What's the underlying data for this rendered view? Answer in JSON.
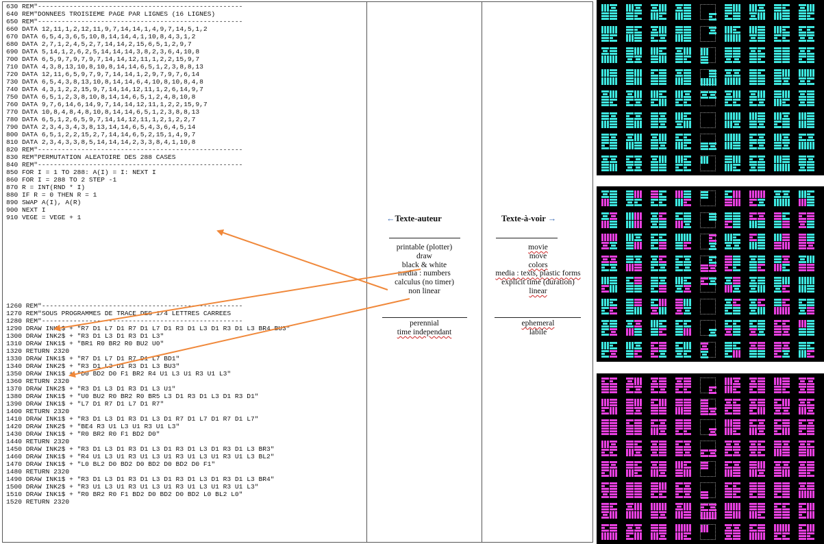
{
  "code_top": [
    "630 REM\"----------------------------------------------------",
    "640 REM\"DONNEES TROISIEME PAGE PAR LIGNES (16 LIGNES)",
    "650 REM\"----------------------------------------------------",
    "660 DATA 12,11,1,2,12,11,9,7,14,14,1,4,9,7,14,5,1,2",
    "670 DATA 6,5,4,3,6,5,10,8,14,14,4,1,10,8,4,3,1,2",
    "680 DATA 2,7,1,2,4,5,2,7,14,14,2,15,6,5,1,2,9,7",
    "690 DATA 5,14,1,2,6,2,5,14,14,14,3,8,2,3,6,4,10,8",
    "700 DATA 6,5,9,7,9,7,9,7,14,14,12,11,1,2,2,15,9,7",
    "710 DATA 4,3,8,13,10,8,10,8,14,14,6,5,1,2,3,8,8,13",
    "720 DATA 12,11,6,5,9,7,9,7,14,14,1,2,9,7,9,7,6,14",
    "730 DATA 6,5,4,3,8,13,10,8,14,14,6,4,10,8,10,8,4,8",
    "740 DATA 4,3,1,2,2,15,9,7,14,14,12,11,1,2,6,14,9,7",
    "750 DATA 6,5,1,2,3,8,10,8,14,14,6,5,1,2,4,8,10,8",
    "760 DATA 9,7,6,14,6,14,9,7,14,14,12,11,1,2,2,15,9,7",
    "770 DATA 10,8,4,8,4,8,10,8,14,14,6,5,1,2,3,8,8,13",
    "780 DATA 6,5,1,2,6,5,9,7,14,14,12,11,1,2,1,2,2,7",
    "790 DATA 2,3,4,3,4,3,8,13,14,14,6,5,4,3,6,4,5,14",
    "800 DATA 6,5,1,2,2,15,2,7,14,14,6,5,2,15,1,4,9,7",
    "810 DATA 2,3,4,3,3,8,5,14,14,14,2,3,3,8,4,1,10,8",
    "820 REM\"----------------------------------------------------",
    "830 REM\"PERMUTATION ALEATOIRE DES 288 CASES",
    "840 REM\"----------------------------------------------------",
    "850 FOR I = 1 TO 288: A(I) = I: NEXT I",
    "860 FOR I = 288 TO 2 STEP -1",
    "870 R = INT(RND * I)",
    "880 IF R = 0 THEN R = 1",
    "890 SWAP A(I), A(R)",
    "900 NEXT I",
    "910 VEGE = VEGE + 1"
  ],
  "code_bottom": [
    "1260 REM\"---------------------------------------------------",
    "1270 REM\"SOUS PROGRAMMES DE TRACE DES 1/4 LETTRES CARREES",
    "1280 REM\"---------------------------------------------------",
    "1290 DRAW INK1$ + \"R7 D1 L7 D1 R7 D1 L7 D1 R3 D1 L3 D1 R3 D1 L3 BR4 BU3\"",
    "1300 DRAW INK2$ + \"R3 D1 L3 D1 R3 D1 L3\"",
    "1310 DRAW INK1$ + \"BR1 R0 BR2 R0 BU2 U0\"",
    "1320 RETURN 2320",
    "1330 DRAW INK1$ + \"R7 D1 L7 D1 R7 D1 L7 BD1\"",
    "1340 DRAW INK2$ + \"R3 D1 L3 D1 R3 D1 L3 BU3\"",
    "1350 DRAW INK1$ + \"D0 BD2 D0 F1 BR2 R4 U1 L3 U1 R3 U1 L3\"",
    "1360 RETURN 2320",
    "1370 DRAW INK2$ + \"R3 D1 L3 D1 R3 D1 L3 U1\"",
    "1380 DRAW INK1$ + \"U0 BU2 R0 BR2 R0 BR5 L3 D1 R3 D1 L3 D1 R3 D1\"",
    "1390 DRAW INK1$ + \"L7 D1 R7 D1 L7 D1 R7\"",
    "1400 RETURN 2320",
    "1410 DRAW INK1$ + \"R3 D1 L3 D1 R3 D1 L3 D1 R7 D1 L7 D1 R7 D1 L7\"",
    "1420 DRAW INK2$ + \"BE4 R3 U1 L3 U1 R3 U1 L3\"",
    "1430 DRAW INK1$ + \"R0 BR2 R0 F1 BD2 D0\"",
    "1440 RETURN 2320",
    "1450 DRAW INK2$ + \"R3 D1 L3 D1 R3 D1 L3 D1 R3 D1 L3 D1 R3 D1 L3 BR3\"",
    "1460 DRAW INK1$ + \"R4 U1 L3 U1 R3 U1 L3 U1 R3 U1 L3 U1 R3 U1 L3 BL2\"",
    "1470 DRAW INK1$ + \"L0 BL2 D0 BD2 D0 BD2 D0 BD2 D0 F1\"",
    "1480 RETURN 2320",
    "1490 DRAW INK1$ + \"R3 D1 L3 D1 R3 D1 L3 D1 R3 D1 L3 D1 R3 D1 L3 BR4\"",
    "1500 DRAW INK2$ + \"R3 U1 L3 U1 R3 U1 L3 U1 R3 U1 L3 U1 R3 U1 L3\"",
    "1510 DRAW INK1$ + \"R0 BR2 R0 F1 BD2 D0 BD2 D0 BD2 L0 BL2 L0\"",
    "1520 RETURN 2320"
  ],
  "author": {
    "heading": "Texte-auteur",
    "props": [
      "printable (plotter)",
      "draw",
      "black & white",
      "media : numbers",
      "calculus (no timer)",
      "non linear"
    ],
    "footer": [
      "perennial",
      "time independant"
    ]
  },
  "view": {
    "heading": "Texte-à-voir",
    "props": [
      "movie",
      "move",
      "colors",
      "media : texts, plastic forms",
      "explicit time (duration)",
      "linear"
    ],
    "footer": [
      "ephemeral",
      "labile"
    ]
  },
  "colors": {
    "arrow": "#f0883a",
    "heading_arrow": "#3a6bb5",
    "panel_bg": "#000000",
    "cyan": "#3ee8e0",
    "magenta": "#e840e0",
    "cell_outline": "#9a9a9a"
  },
  "panels": [
    {
      "name": "cyan",
      "mode": "cyan"
    },
    {
      "name": "mixed",
      "mode": "mixed"
    },
    {
      "name": "magenta",
      "mode": "magenta"
    }
  ]
}
